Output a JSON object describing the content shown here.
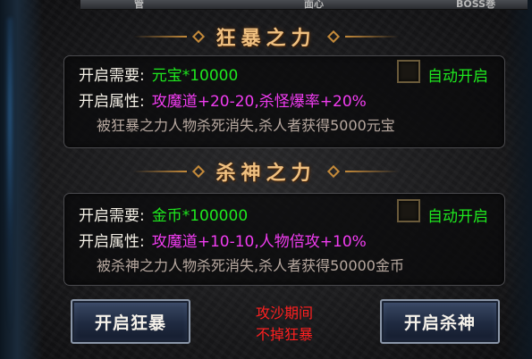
{
  "top_banner": {
    "left_fragment": "管",
    "mid_fragment": "面心",
    "right_fragment": "BOSS巻"
  },
  "rage": {
    "title": "狂暴之力",
    "require_label": "开启需要:",
    "require_value": "元宝*10000",
    "attr_label": "开启属性:",
    "attr_value": "攻魔道+20-20,杀怪爆率+20%",
    "description": "被狂暴之力人物杀死消失,杀人者获得5000元宝",
    "auto_label": "自动开启",
    "auto_checked": false
  },
  "slay": {
    "title": "杀神之力",
    "require_label": "开启需要:",
    "require_value": "金币*100000",
    "attr_label": "开启属性:",
    "attr_value": "攻魔道+10-10,人物倍攻+10%",
    "description": "被杀神之力人物杀死消失,杀人者获得50000金币",
    "auto_label": "自动开启",
    "auto_checked": false
  },
  "buttons": {
    "rage_button": "开启狂暴",
    "slay_button": "开启杀神"
  },
  "notice": {
    "line1": "攻沙期间",
    "line2": "不掉狂暴"
  },
  "colors": {
    "value_green": "#1ee81e",
    "value_magenta": "#f03cf0",
    "title_gold": "#f0c080",
    "notice_red": "#ff2020"
  }
}
